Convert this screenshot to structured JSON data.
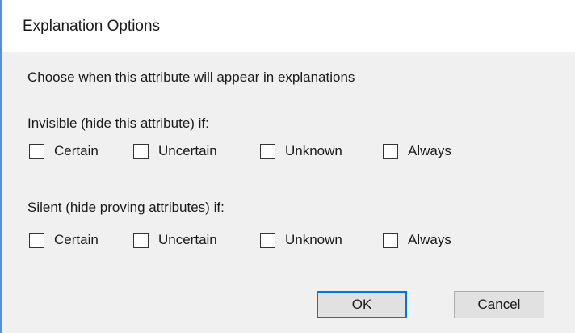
{
  "window": {
    "title": "Explanation Options"
  },
  "main": {
    "instruction": "Choose when this attribute will appear in explanations",
    "groups": [
      {
        "label": "Invisible (hide this attribute) if:",
        "options": [
          {
            "label": "Certain",
            "checked": false
          },
          {
            "label": "Uncertain",
            "checked": false
          },
          {
            "label": "Unknown",
            "checked": false
          },
          {
            "label": "Always",
            "checked": false
          }
        ]
      },
      {
        "label": "Silent (hide proving attributes) if:",
        "options": [
          {
            "label": "Certain",
            "checked": false
          },
          {
            "label": "Uncertain",
            "checked": false
          },
          {
            "label": "Unknown",
            "checked": false
          },
          {
            "label": "Always",
            "checked": false
          }
        ]
      }
    ]
  },
  "buttons": {
    "ok_label": "OK",
    "cancel_label": "Cancel"
  },
  "colors": {
    "accent": "#0078d7",
    "window_border": "#5b8fd0",
    "client_background": "#f0f0f0"
  }
}
